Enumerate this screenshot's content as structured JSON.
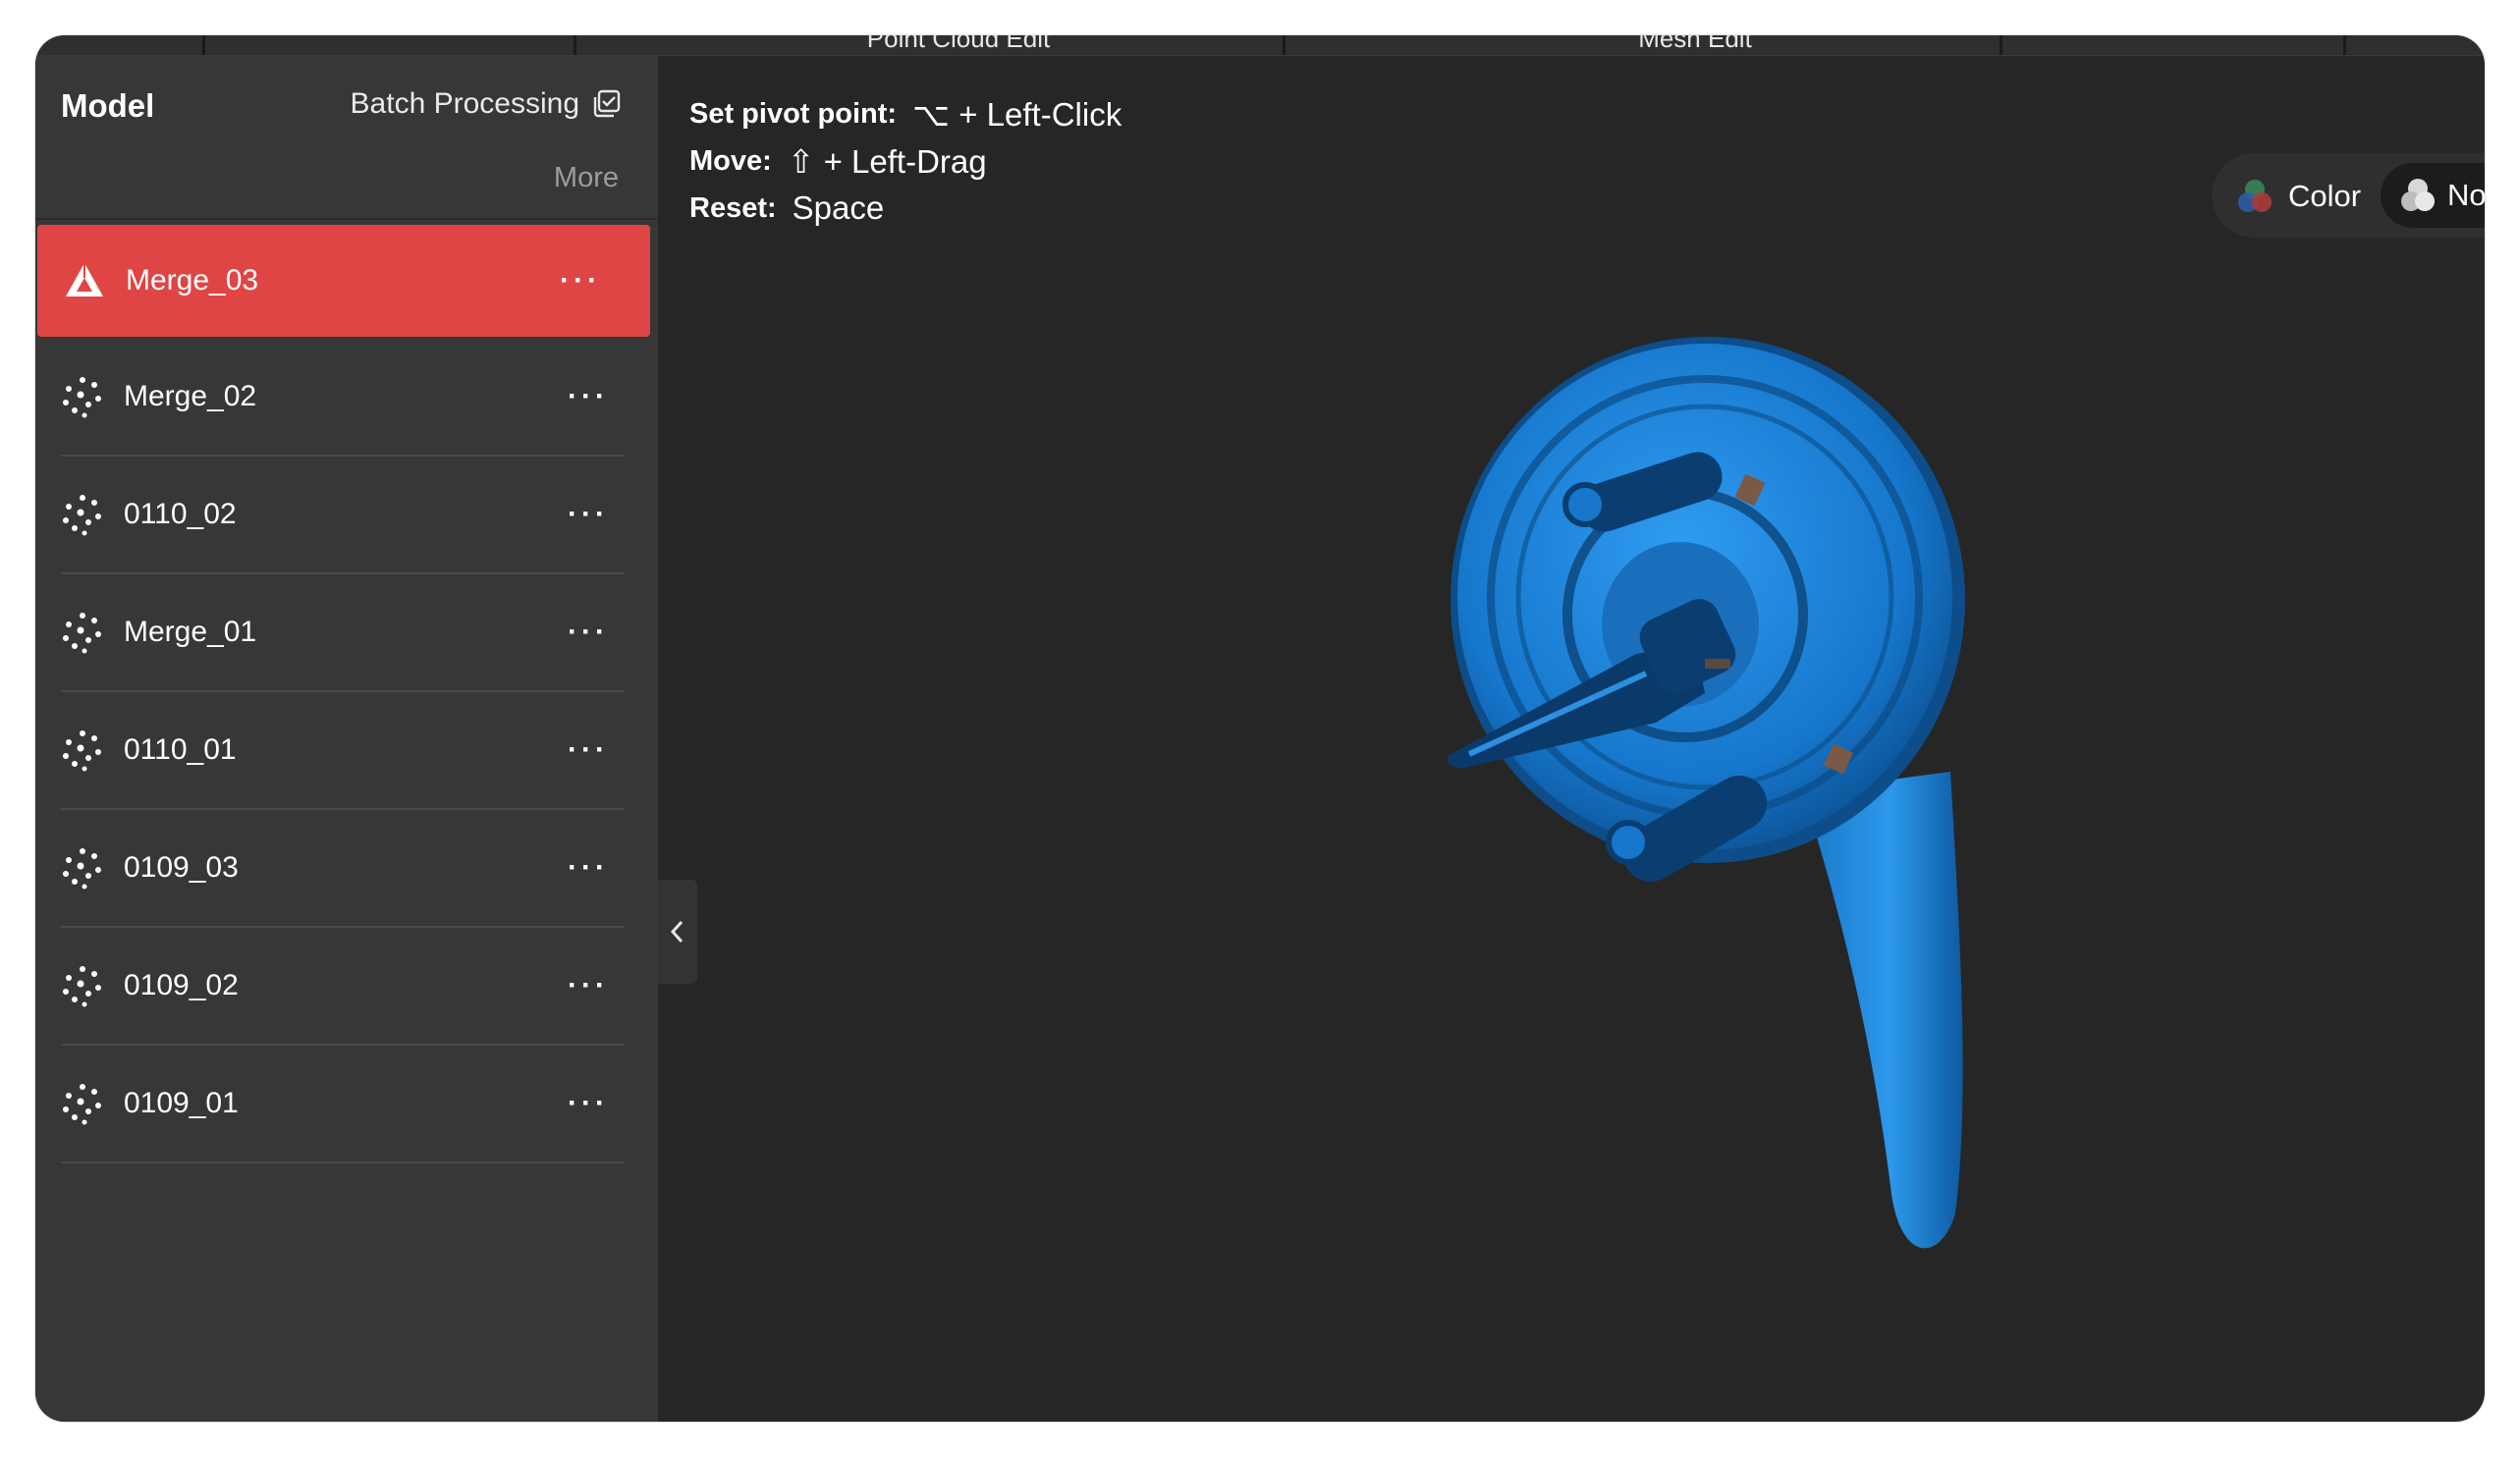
{
  "topbar": {
    "tabs": [
      "Point Cloud Edit",
      "Mesh Edit"
    ]
  },
  "sidebar": {
    "title": "Model",
    "batch_label": "Batch Processing",
    "more_label": "More",
    "items": [
      {
        "label": "Merge_03",
        "type": "mesh",
        "active": true
      },
      {
        "label": "Merge_02",
        "type": "point-cloud"
      },
      {
        "label": "0110_02",
        "type": "point-cloud"
      },
      {
        "label": "Merge_01",
        "type": "point-cloud"
      },
      {
        "label": "0110_01",
        "type": "point-cloud"
      },
      {
        "label": "0109_03",
        "type": "point-cloud"
      },
      {
        "label": "0109_02",
        "type": "point-cloud"
      },
      {
        "label": "0109_01",
        "type": "point-cloud"
      }
    ],
    "item_menu": "···"
  },
  "hints": {
    "pivot": {
      "key": "Set pivot point:",
      "value": "⌥ + Left-Click"
    },
    "move": {
      "key": "Move:",
      "value": "⇧ + Left-Drag"
    },
    "reset": {
      "key": "Reset:",
      "value": "Space"
    }
  },
  "view_toggle": {
    "color_label": "Color",
    "no_label": "No"
  },
  "colors": {
    "accent": "#e04545",
    "model": "#1a7fd6",
    "panel": "#373737",
    "viewport": "#262626"
  }
}
